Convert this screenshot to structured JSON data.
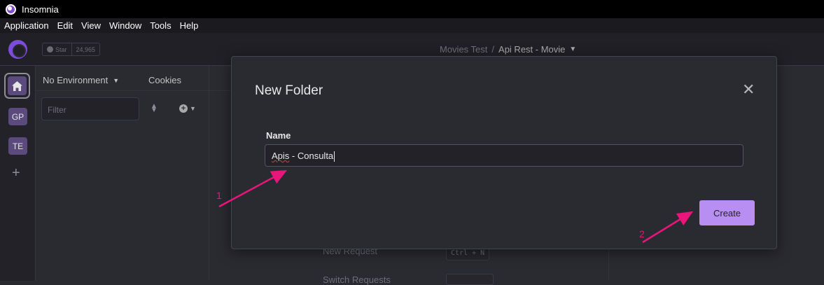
{
  "window": {
    "title": "Insomnia"
  },
  "menu": [
    "Application",
    "Edit",
    "View",
    "Window",
    "Tools",
    "Help"
  ],
  "topbar": {
    "star_label": "Star",
    "star_count": "24,965",
    "breadcrumb_project": "Movies Test",
    "breadcrumb_separator": "/",
    "breadcrumb_current": "Api Rest - Movie"
  },
  "workspaces": [
    {
      "label": "GP"
    },
    {
      "label": "TE"
    }
  ],
  "sidebar": {
    "environment": "No Environment",
    "cookies": "Cookies",
    "filter_placeholder": "Filter"
  },
  "background_hints": [
    {
      "label": "New Request",
      "shortcut": "Ctrl + N"
    },
    {
      "label": "Switch Requests",
      "shortcut": ""
    }
  ],
  "modal": {
    "title": "New Folder",
    "field_label": "Name",
    "field_value_misspelled": "Apis",
    "field_value_rest": " - Consulta",
    "submit_label": "Create"
  },
  "annotations": [
    {
      "label": "1"
    },
    {
      "label": "2"
    }
  ],
  "colors": {
    "accent": "#b98ef2",
    "brand": "#7d4cdb",
    "annotation": "#e8157a",
    "background": "#2a2a31"
  }
}
